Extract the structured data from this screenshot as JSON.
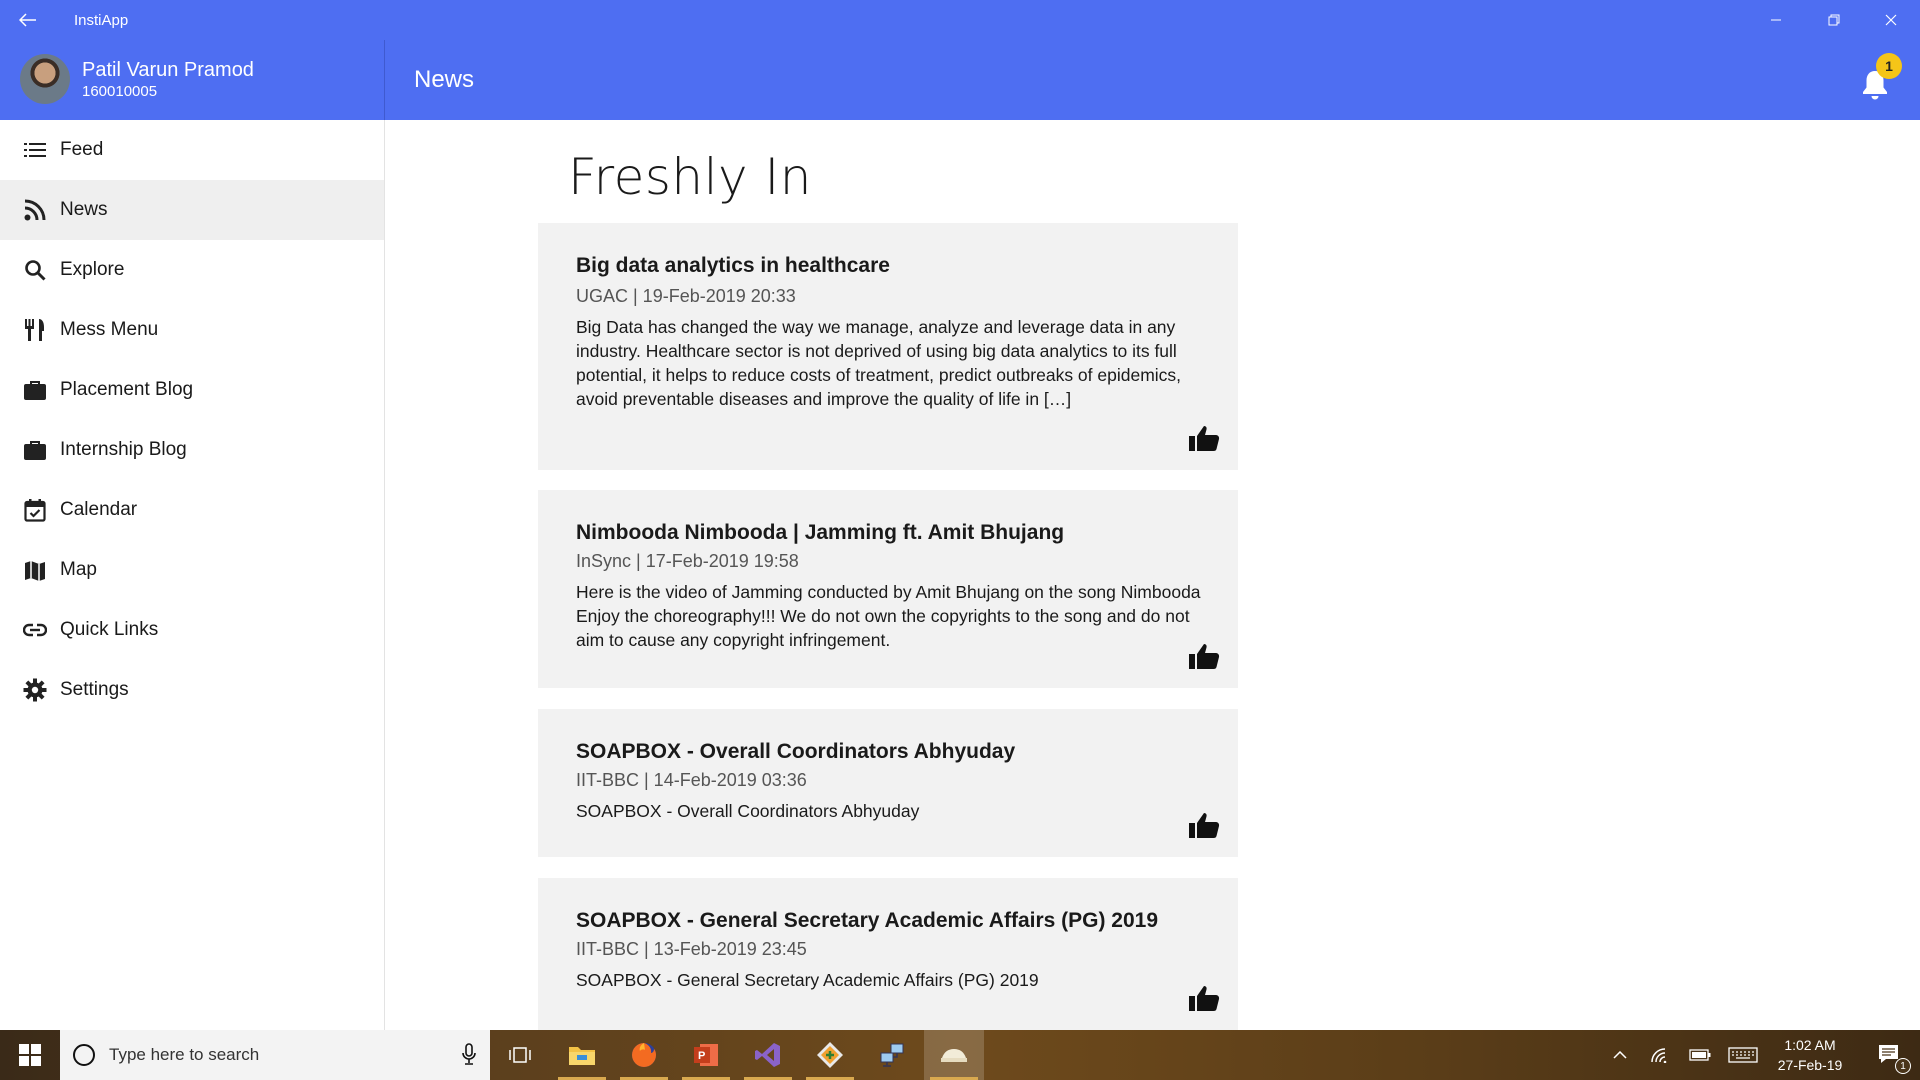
{
  "window": {
    "title": "InstiApp"
  },
  "user": {
    "name": "Patil Varun Pramod",
    "id": "160010005"
  },
  "header": {
    "page_title": "News",
    "notification_count": "1"
  },
  "sidebar": {
    "items": [
      {
        "label": "Feed",
        "icon": "list-icon"
      },
      {
        "label": "News",
        "icon": "rss-icon",
        "active": true
      },
      {
        "label": "Explore",
        "icon": "search-icon"
      },
      {
        "label": "Mess Menu",
        "icon": "fork-knife-icon"
      },
      {
        "label": "Placement Blog",
        "icon": "briefcase-icon"
      },
      {
        "label": "Internship Blog",
        "icon": "briefcase-icon"
      },
      {
        "label": "Calendar",
        "icon": "calendar-check-icon"
      },
      {
        "label": "Map",
        "icon": "map-icon"
      },
      {
        "label": "Quick Links",
        "icon": "link-icon"
      },
      {
        "label": "Settings",
        "icon": "gear-icon"
      }
    ]
  },
  "main": {
    "section_title": "Freshly In",
    "articles": [
      {
        "title": "Big data analytics in healthcare",
        "meta": "UGAC | 19-Feb-2019 20:33",
        "body": "Big Data has changed the way we manage, analyze and leverage data in any industry. Healthcare sector is not deprived of using big data analytics to its full potential, it helps to reduce costs of treatment, predict outbreaks of epidemics, avoid preventable diseases and improve the quality of life in […]"
      },
      {
        "title": "Nimbooda Nimbooda | Jamming ft. Amit Bhujang",
        "meta": "InSync | 17-Feb-2019 19:58",
        "body": "Here is the video of Jamming conducted by Amit Bhujang on the song Nimbooda Enjoy the choreography!!! We do not own the copyrights to the song and do not aim to cause any copyright infringement."
      },
      {
        "title": "SOAPBOX - Overall Coordinators Abhyuday",
        "meta": "IIT-BBC | 14-Feb-2019 03:36",
        "body": "SOAPBOX - Overall Coordinators Abhyuday"
      },
      {
        "title": "SOAPBOX - General Secretary Academic Affairs (PG) 2019",
        "meta": "IIT-BBC | 13-Feb-2019 23:45",
        "body": "SOAPBOX - General Secretary Academic Affairs (PG) 2019"
      }
    ]
  },
  "taskbar": {
    "search_placeholder": "Type here to search",
    "time": "1:02 AM",
    "date": "27-Feb-19",
    "notification_count": "1"
  },
  "colors": {
    "accent": "#4e6ef2",
    "card_bg": "#f2f2f2",
    "badge": "#f5c518"
  }
}
